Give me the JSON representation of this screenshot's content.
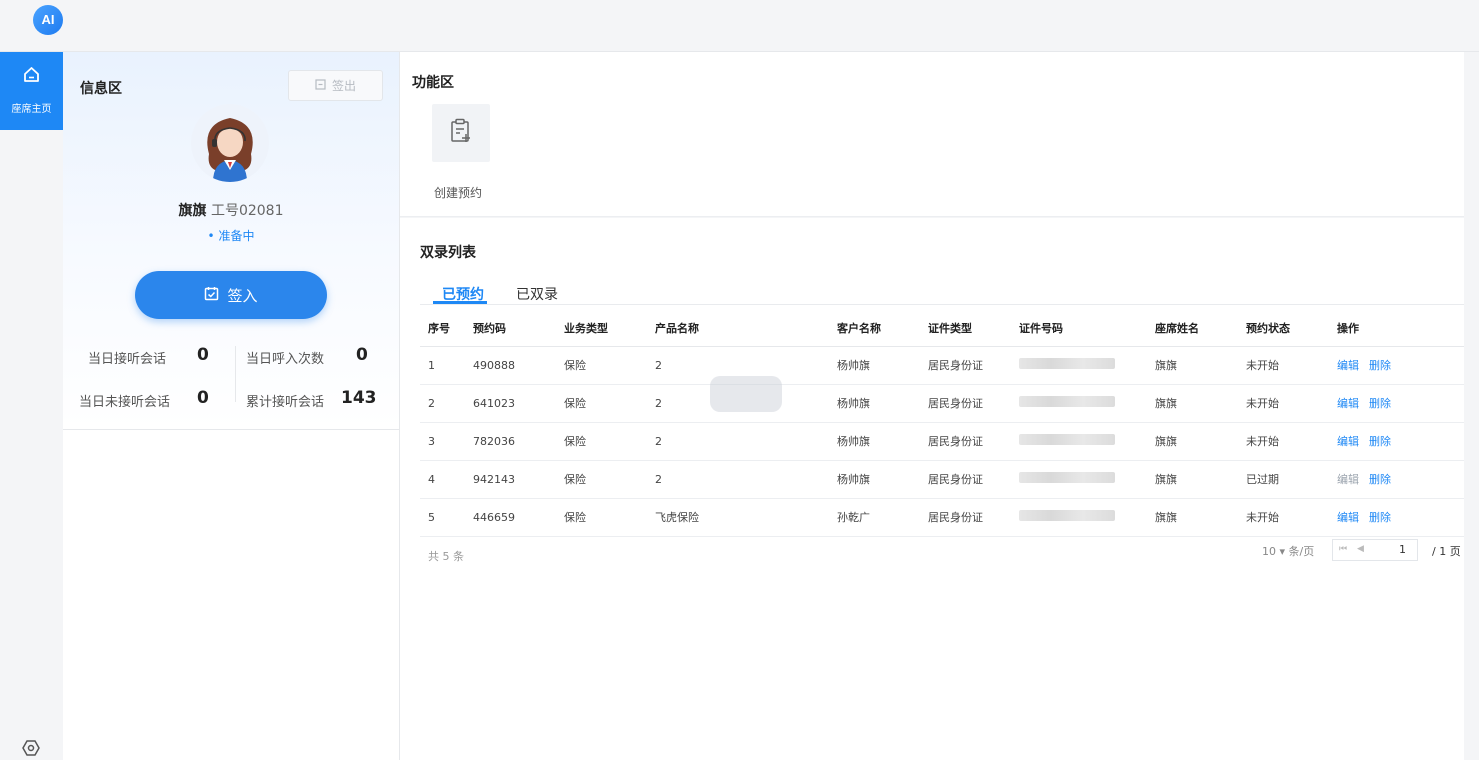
{
  "app": {
    "logo_text": "AI"
  },
  "nav": {
    "home_label": "座席主页"
  },
  "info": {
    "title": "信息区",
    "signout_label": "签出",
    "agent_name": "旗旗",
    "agent_id": "工号02081",
    "status": "• 准备中",
    "signin_label": "签入",
    "stats": [
      {
        "label": "当日接听会话",
        "value": "0"
      },
      {
        "label": "当日呼入次数",
        "value": "0"
      },
      {
        "label": "当日未接听会话",
        "value": "0"
      },
      {
        "label": "累计接听会话",
        "value": "143"
      }
    ]
  },
  "functions": {
    "title": "功能区",
    "items": [
      {
        "label": "创建预约",
        "icon": "clipboard-add-icon"
      }
    ]
  },
  "list": {
    "title": "双录列表",
    "tabs": [
      {
        "label": "已预约",
        "active": true
      },
      {
        "label": "已双录",
        "active": false
      }
    ],
    "columns": [
      "序号",
      "预约码",
      "业务类型",
      "产品名称",
      "客户名称",
      "证件类型",
      "证件号码",
      "座席姓名",
      "预约状态",
      "操作"
    ],
    "rows": [
      {
        "no": "1",
        "code": "490888",
        "biz": "保险",
        "product": "2",
        "customer": "杨帅旗",
        "id_type": "居民身份证",
        "agent": "旗旗",
        "status": "未开始",
        "edit": "编辑",
        "edit_enabled": true,
        "del": "删除"
      },
      {
        "no": "2",
        "code": "641023",
        "biz": "保险",
        "product": "2",
        "customer": "杨帅旗",
        "id_type": "居民身份证",
        "agent": "旗旗",
        "status": "未开始",
        "edit": "编辑",
        "edit_enabled": true,
        "del": "删除"
      },
      {
        "no": "3",
        "code": "782036",
        "biz": "保险",
        "product": "2",
        "customer": "杨帅旗",
        "id_type": "居民身份证",
        "agent": "旗旗",
        "status": "未开始",
        "edit": "编辑",
        "edit_enabled": true,
        "del": "删除"
      },
      {
        "no": "4",
        "code": "942143",
        "biz": "保险",
        "product": "2",
        "customer": "杨帅旗",
        "id_type": "居民身份证",
        "agent": "旗旗",
        "status": "已过期",
        "edit": "编辑",
        "edit_enabled": false,
        "del": "删除"
      },
      {
        "no": "5",
        "code": "446659",
        "biz": "保险",
        "product": "飞虎保险",
        "customer": "孙乾广",
        "id_type": "居民身份证",
        "agent": "旗旗",
        "status": "未开始",
        "edit": "编辑",
        "edit_enabled": true,
        "del": "删除"
      }
    ],
    "total": "共 5 条",
    "page_size": "10 ▾ 条/页",
    "page_current": "1",
    "page_total": "/ 1 页"
  },
  "colors": {
    "accent": "#1e88f5",
    "button": "#2b86ec"
  }
}
